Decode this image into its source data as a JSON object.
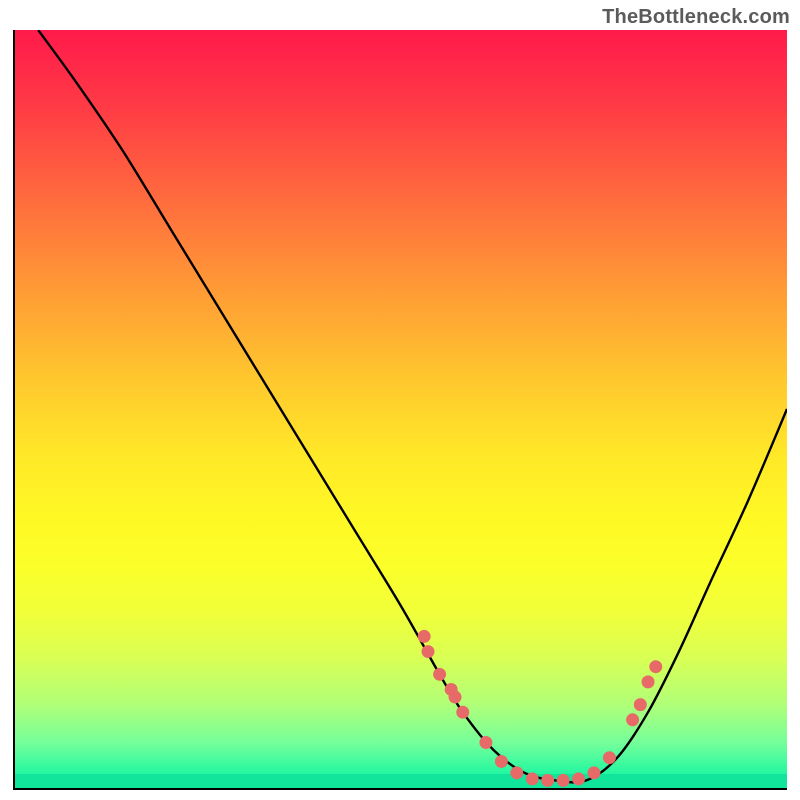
{
  "watermark": "TheBottleneck.com",
  "chart_data": {
    "type": "line",
    "title": "",
    "xlabel": "",
    "ylabel": "",
    "xlim": [
      0,
      100
    ],
    "ylim": [
      0,
      100
    ],
    "grid": false,
    "legend": false,
    "series": [
      {
        "name": "bottleneck-curve",
        "x": [
          3,
          8,
          14,
          20,
          26,
          32,
          38,
          44,
          50,
          55,
          58,
          62,
          66,
          70,
          74,
          78,
          82,
          86,
          90,
          95,
          100
        ],
        "y": [
          100,
          93,
          84,
          74,
          64,
          54,
          44,
          34,
          24,
          15,
          10,
          5,
          2,
          1,
          1,
          4,
          10,
          18,
          27,
          38,
          50
        ]
      }
    ],
    "points": {
      "name": "highlight-dots",
      "x": [
        53,
        53.5,
        55,
        56.5,
        57,
        58,
        61,
        63,
        65,
        67,
        69,
        71,
        73,
        75,
        77,
        80,
        81,
        82,
        83
      ],
      "y": [
        20,
        18,
        15,
        13,
        12,
        10,
        6,
        3.5,
        2,
        1.2,
        1,
        1,
        1.2,
        2,
        4,
        9,
        11,
        14,
        16
      ]
    },
    "gradient_stops": [
      {
        "pos": 0,
        "color": "#ff1a4b"
      },
      {
        "pos": 50,
        "color": "#ffe828"
      },
      {
        "pos": 100,
        "color": "#07e69a"
      }
    ]
  }
}
